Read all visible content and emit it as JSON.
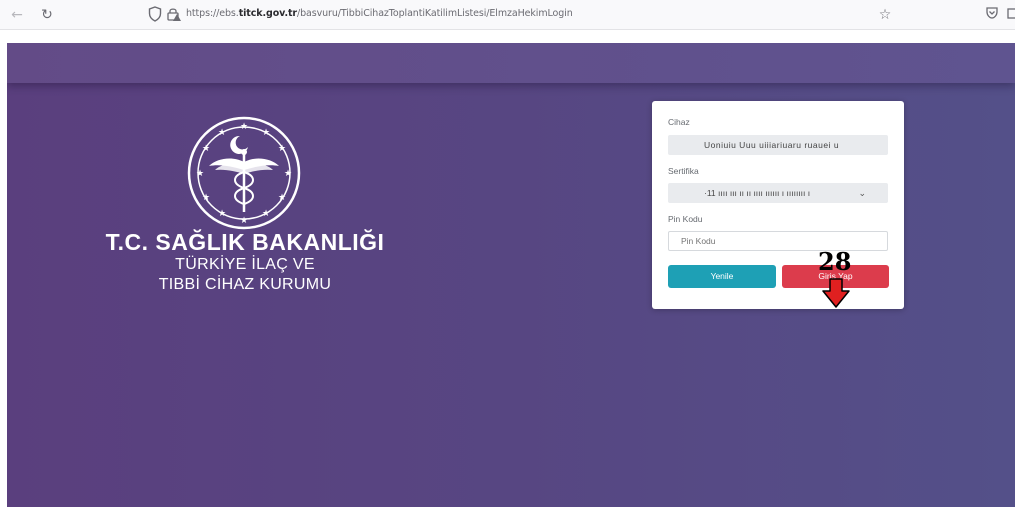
{
  "browser": {
    "back_icon": "←",
    "reload_icon": "↻",
    "url_prefix": "https://ebs.",
    "url_host": "titck.gov.tr",
    "url_path": "/basvuru/TibbiCihazToplantiKatilimListesi/ElmzaHekimLogin",
    "bookmark_icon": "☆",
    "pocket_icon": "◡"
  },
  "organization": {
    "name": "T.C. SAĞLIK BAKANLIĞI",
    "subtitle_line1": "TÜRKİYE İLAÇ VE",
    "subtitle_line2": "TIBBİ CİHAZ KURUMU"
  },
  "login_form": {
    "device_label": "Cihaz",
    "device_value": "Uoniuiu Uuu uiiiariuaru ruauei u",
    "certificate_label": "Sertifika",
    "certificate_value": "·11 ıııı ııı ıı ıı ıııı ıııııı ı ıııııııı ı",
    "certificate_chevron": "⌄",
    "pin_label": "Pin Kodu",
    "pin_placeholder": "Pin Kodu",
    "pin_value": "",
    "refresh_button": "Yenile",
    "login_button": "Giriş Yap",
    "colors": {
      "refresh": "#1ea0b5",
      "login": "#dc3c4c"
    }
  },
  "annotation": {
    "step_number": "28",
    "arrow_color": "#e02020"
  }
}
